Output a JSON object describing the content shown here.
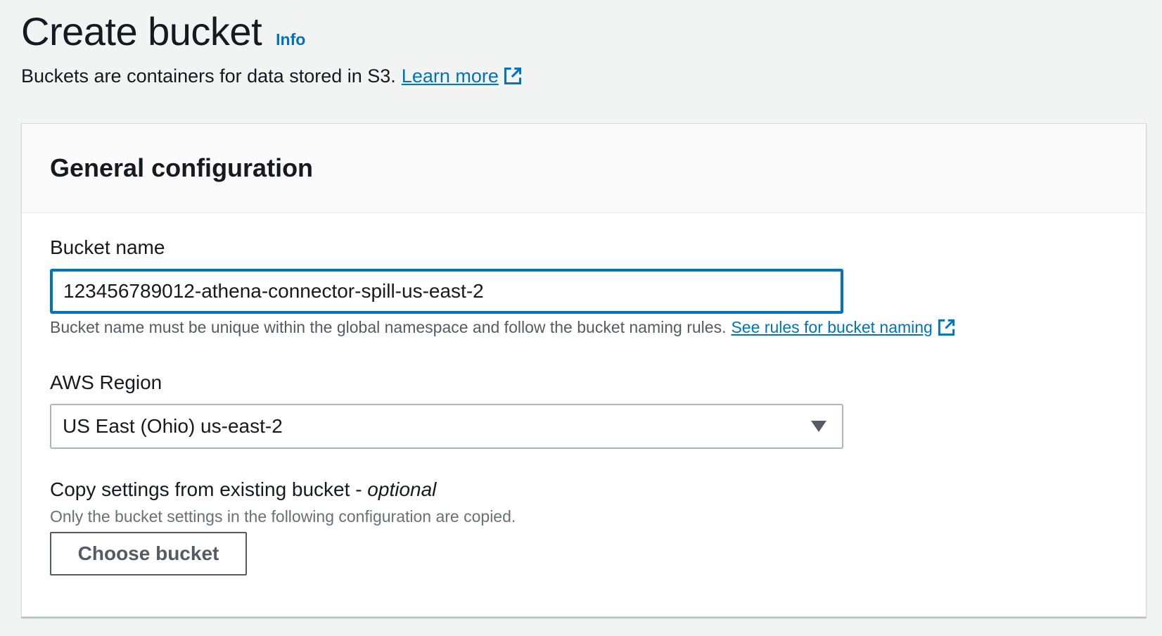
{
  "header": {
    "title": "Create bucket",
    "info_label": "Info",
    "description": "Buckets are containers for data stored in S3.",
    "learn_more_label": "Learn more"
  },
  "general_configuration": {
    "title": "General configuration",
    "bucket_name": {
      "label": "Bucket name",
      "value": "123456789012-athena-connector-spill-us-east-2",
      "constraint": "Bucket name must be unique within the global namespace and follow the bucket naming rules.",
      "rules_link_label": "See rules for bucket naming"
    },
    "aws_region": {
      "label": "AWS Region",
      "selected": "US East (Ohio) us-east-2"
    },
    "copy_settings": {
      "label": "Copy settings from existing bucket -",
      "label_optional": "optional",
      "description": "Only the bucket settings in the following configuration are copied.",
      "button_label": "Choose bucket"
    }
  },
  "colors": {
    "link": "#0073bb",
    "background": "#f2f3f3",
    "text": "#16191f",
    "secondary_text": "#545b64"
  },
  "icons": {
    "external_link": "external-link-icon",
    "dropdown": "caret-down-icon"
  }
}
